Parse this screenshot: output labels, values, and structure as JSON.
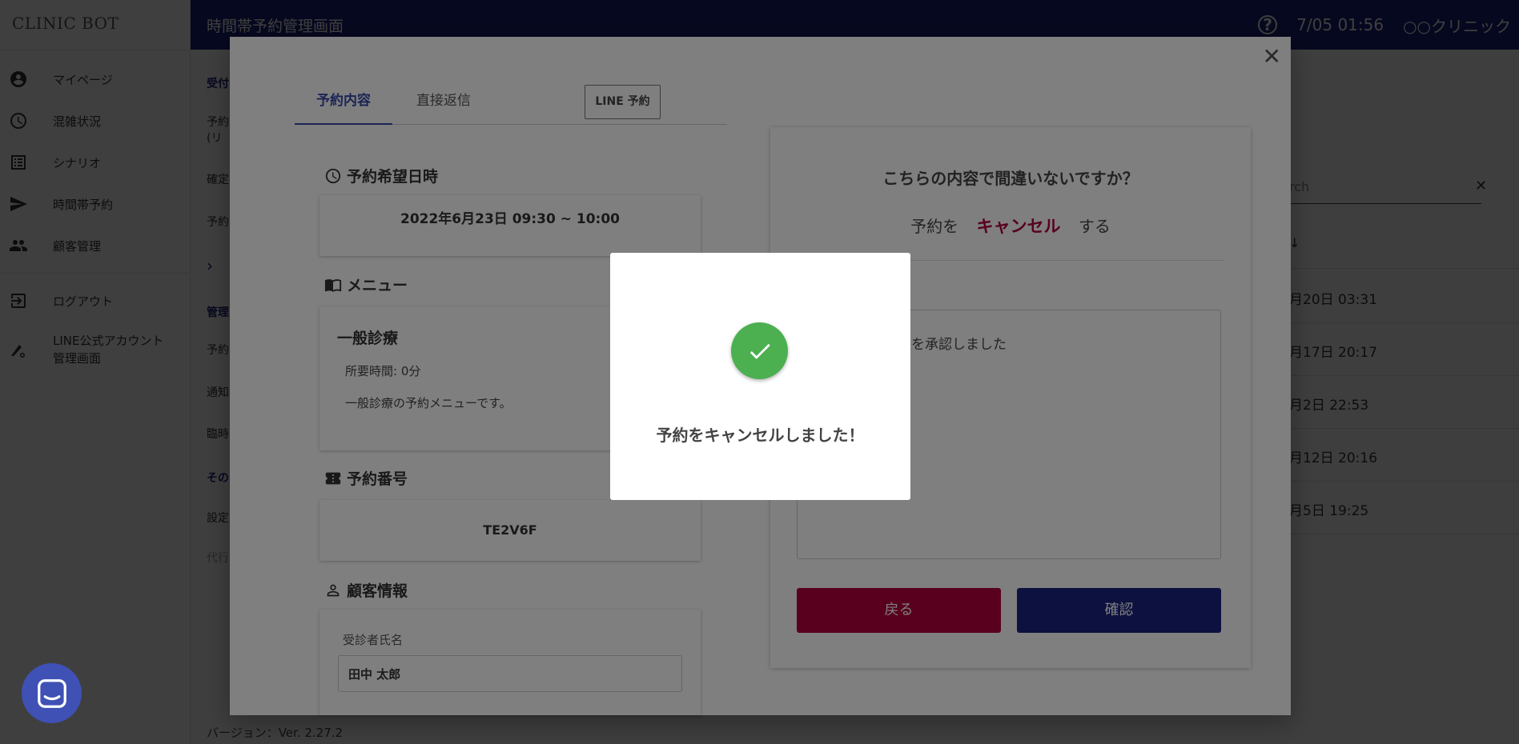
{
  "app": {
    "brand": "CLINIC BOT"
  },
  "sidebar": {
    "items": [
      {
        "label": "マイページ",
        "icon": "account-circle-icon"
      },
      {
        "label": "混雑状況",
        "icon": "clock-icon"
      },
      {
        "label": "シナリオ",
        "icon": "list-icon"
      },
      {
        "label": "時間帯予約",
        "icon": "send-icon"
      },
      {
        "label": "顧客管理",
        "icon": "people-icon"
      },
      {
        "label": "ログアウト",
        "icon": "logout-icon"
      },
      {
        "label": "LINE公式アカウント管理画面",
        "line1": "LINE公式アカウント",
        "line2": "管理画面",
        "icon": "admin-settings-icon"
      }
    ]
  },
  "header": {
    "title": "時間帯予約管理画面",
    "datetime": "7/05 01:56",
    "clinic_name": "○○クリニック",
    "help_icon": "help-icon"
  },
  "background_left": {
    "items": [
      "受付",
      "予約",
      "(リ",
      "確定",
      "予約",
      "管理",
      "予約",
      "通知",
      "臨時",
      "その",
      "設定",
      "代行"
    ]
  },
  "background_right": {
    "search_placeholder": "rch",
    "clear_icon": "close-icon",
    "sort_icon": "arrow-down-icon",
    "rows": [
      "月20日 03:31",
      "月17日 20:17",
      "月2日 22:53",
      "月12日 20:16",
      "月5日 19:25"
    ]
  },
  "footer": {
    "version": "バージョン：Ver. 2.27.2"
  },
  "modal": {
    "close_icon": "close-icon",
    "tabs": [
      {
        "label": "予約内容",
        "active": true
      },
      {
        "label": "直接返信",
        "active": false
      }
    ],
    "line_button": "LINE 予約",
    "sections": {
      "datetime": {
        "title": "予約希望日時",
        "value": "2022年6月23日 09:30 ~ 10:00"
      },
      "menu": {
        "title": "メニュー",
        "name": "一般診療",
        "duration": "所要時間: 0分",
        "description": "一般診療の予約メニューです。"
      },
      "number": {
        "title": "予約番号",
        "value": "TE2V6F"
      },
      "customer": {
        "title": "顧客情報",
        "field_label": "受診者氏名",
        "field_value": "田中 太郎"
      }
    },
    "confirm": {
      "question": "こちらの内容で間違いないですか？",
      "action_prefix": "予約を",
      "action_word": "キャンセル",
      "action_suffix": "する",
      "message_visible": "願を承認しました",
      "back_label": "戻る",
      "confirm_label": "確認"
    }
  },
  "dialog": {
    "message": "予約をキャンセルしました！",
    "icon": "check-icon"
  },
  "colors": {
    "header": "#1a237e",
    "danger": "#b0003a",
    "primary": "#1a237e",
    "tab_active": "#3949ab",
    "success": "#4caf50",
    "chat_fab": "#3f51b5"
  }
}
